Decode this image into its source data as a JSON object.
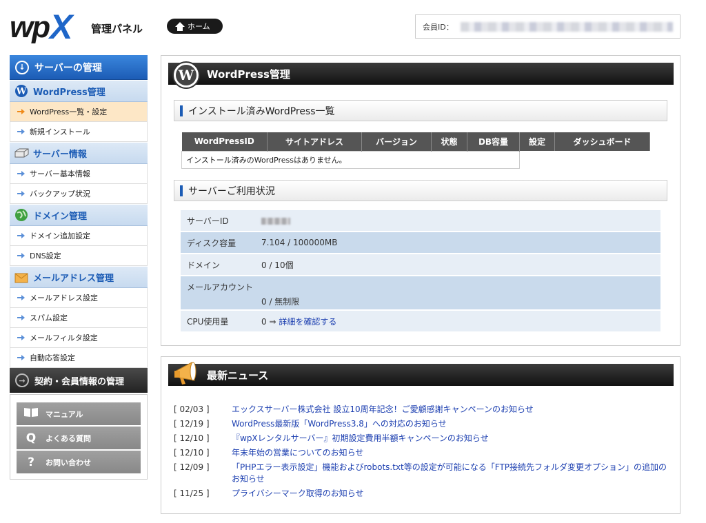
{
  "header": {
    "logo_wp": "wp",
    "logo_x": "X",
    "logo_sub": "管理パネル",
    "home_label": "ホーム",
    "member_id_label": "会員ID："
  },
  "sidebar": {
    "server_mgmt": "サーバーの管理",
    "sections": [
      {
        "title": "WordPress管理",
        "items": [
          "WordPress一覧・設定",
          "新規インストール"
        ]
      },
      {
        "title": "サーバー情報",
        "items": [
          "サーバー基本情報",
          "バックアップ状況"
        ]
      },
      {
        "title": "ドメイン管理",
        "items": [
          "ドメイン追加設定",
          "DNS設定"
        ]
      },
      {
        "title": "メールアドレス管理",
        "items": [
          "メールアドレス設定",
          "スパム設定",
          "メールフィルタ設定",
          "自動応答設定"
        ]
      }
    ],
    "contract": "契約・会員情報の管理",
    "help": [
      {
        "label": "マニュアル",
        "icon": "book-icon"
      },
      {
        "label": "よくある質問",
        "icon": "q-icon"
      },
      {
        "label": "お問い合わせ",
        "icon": "question-icon"
      }
    ]
  },
  "wp_panel": {
    "title": "WordPress管理",
    "installed_heading": "インストール済みWordPress一覧",
    "columns": [
      "WordPressID",
      "サイトアドレス",
      "バージョン",
      "状態",
      "DB容量",
      "設定",
      "ダッシュボード"
    ],
    "empty_message": "インストール済みのWordPressはありません。",
    "usage_heading": "サーバーご利用状況",
    "usage": {
      "server_id_label": "サーバーID",
      "disk_label": "ディスク容量",
      "disk_value": "7.104 / 100000MB",
      "domain_label": "ドメイン",
      "domain_value": "0 / 10個",
      "mail_label": "メールアカウント",
      "mail_value": "0 / 無制限",
      "cpu_label": "CPU使用量",
      "cpu_value": "0 ⇒ ",
      "cpu_link": "詳細を確認する"
    }
  },
  "news": {
    "title": "最新ニュース",
    "items": [
      {
        "date": "[ 02/03 ]",
        "title": "エックスサーバー株式会社 設立10周年記念！ご愛顧感謝キャンペーンのお知らせ"
      },
      {
        "date": "[ 12/19 ]",
        "title": "WordPress最新版「WordPress3.8」への対応のお知らせ"
      },
      {
        "date": "[ 12/10 ]",
        "title": "『wpXレンタルサーバー』初期設定費用半額キャンペーンのお知らせ"
      },
      {
        "date": "[ 12/10 ]",
        "title": "年末年始の営業についてのお知らせ"
      },
      {
        "date": "[ 12/09 ]",
        "title": "「PHPエラー表示設定」機能およびrobots.txt等の設定が可能になる「FTP接続先フォルダ変更オプション」の追加のお知らせ"
      },
      {
        "date": "[ 11/25 ]",
        "title": "プライバシーマーク取得のお知らせ"
      }
    ]
  }
}
